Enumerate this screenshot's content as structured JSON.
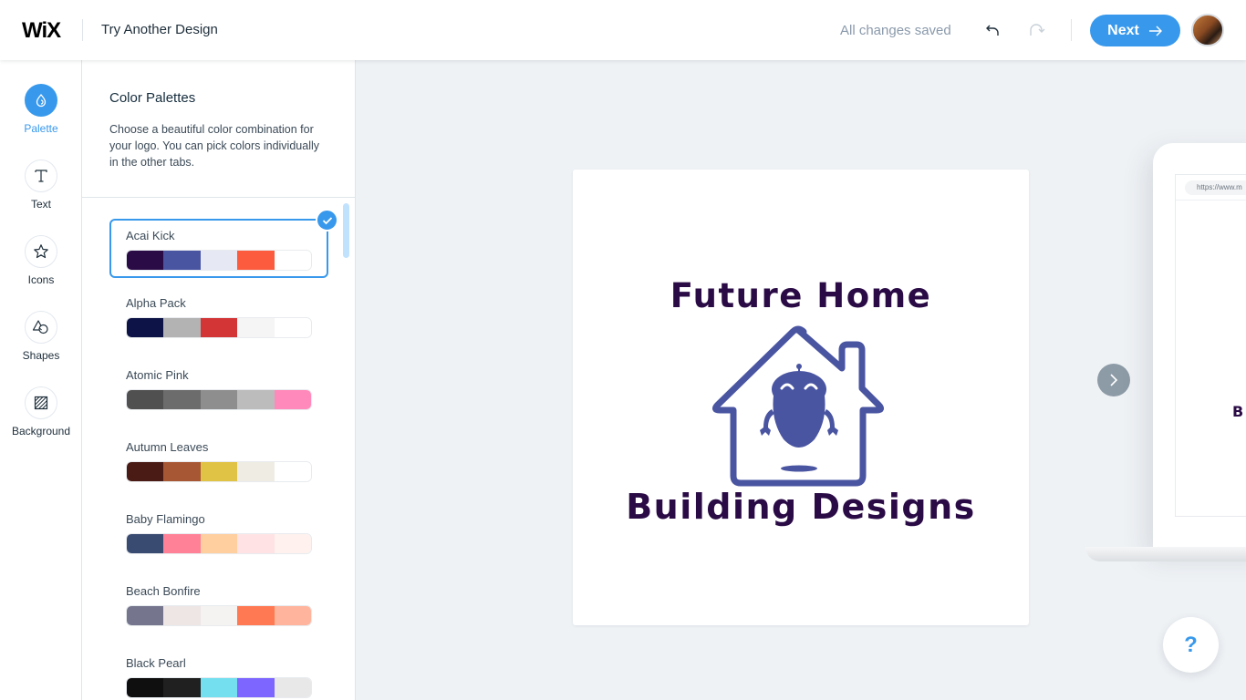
{
  "header": {
    "brand": "WiX",
    "title": "Try Another Design",
    "save_status": "All changes saved",
    "undo_icon": "undo-icon",
    "redo_icon": "redo-icon",
    "next_label": "Next",
    "next_icon": "arrow-right-icon",
    "avatar_icon": "user-avatar"
  },
  "rail": {
    "items": [
      {
        "label": "Palette",
        "icon": "drop-icon",
        "active": true
      },
      {
        "label": "Text",
        "icon": "text-icon",
        "active": false
      },
      {
        "label": "Icons",
        "icon": "star-icon",
        "active": false
      },
      {
        "label": "Shapes",
        "icon": "shapes-icon",
        "active": false
      },
      {
        "label": "Background",
        "icon": "background-icon",
        "active": false
      }
    ]
  },
  "panel": {
    "title": "Color Palettes",
    "description": "Choose a beautiful color combination for your logo. You can pick colors individually in the other tabs.",
    "palettes": [
      {
        "name": "Acai Kick",
        "selected": true,
        "colors": [
          "#2a0b45",
          "#4a55a2",
          "#e6e8f4",
          "#fc5c3d",
          "#ffffff"
        ]
      },
      {
        "name": "Alpha Pack",
        "selected": false,
        "colors": [
          "#0d1346",
          "#b3b3b3",
          "#d33537",
          "#f5f5f5",
          "#ffffff"
        ]
      },
      {
        "name": "Atomic Pink",
        "selected": false,
        "colors": [
          "#505050",
          "#6c6c6c",
          "#8e8e8e",
          "#bcbcbc",
          "#ff89ba"
        ]
      },
      {
        "name": "Autumn Leaves",
        "selected": false,
        "colors": [
          "#4a1a14",
          "#a85734",
          "#e0c244",
          "#efede3",
          "#ffffff"
        ]
      },
      {
        "name": "Baby Flamingo",
        "selected": false,
        "colors": [
          "#3a4b72",
          "#ff8197",
          "#ffcfa0",
          "#ffe3e4",
          "#fff1ee"
        ]
      },
      {
        "name": "Beach Bonfire",
        "selected": false,
        "colors": [
          "#76758e",
          "#ede6e5",
          "#f4f3f1",
          "#ff7a53",
          "#ffb59d"
        ]
      },
      {
        "name": "Black Pearl",
        "selected": false,
        "colors": [
          "#0f0f0f",
          "#202020",
          "#74e0ef",
          "#7c66ff",
          "#e8e8e8"
        ]
      }
    ]
  },
  "stage": {
    "logo": {
      "line1": "Future Home",
      "line2": "Building Designs",
      "text_color": "#2a0b45",
      "icon_color": "#4a55a2",
      "icon": "robot-house-icon"
    },
    "next_design_icon": "chevron-right-icon",
    "preview": {
      "url": "https://www.m",
      "logo_fragment": "B"
    },
    "help_label": "?"
  }
}
